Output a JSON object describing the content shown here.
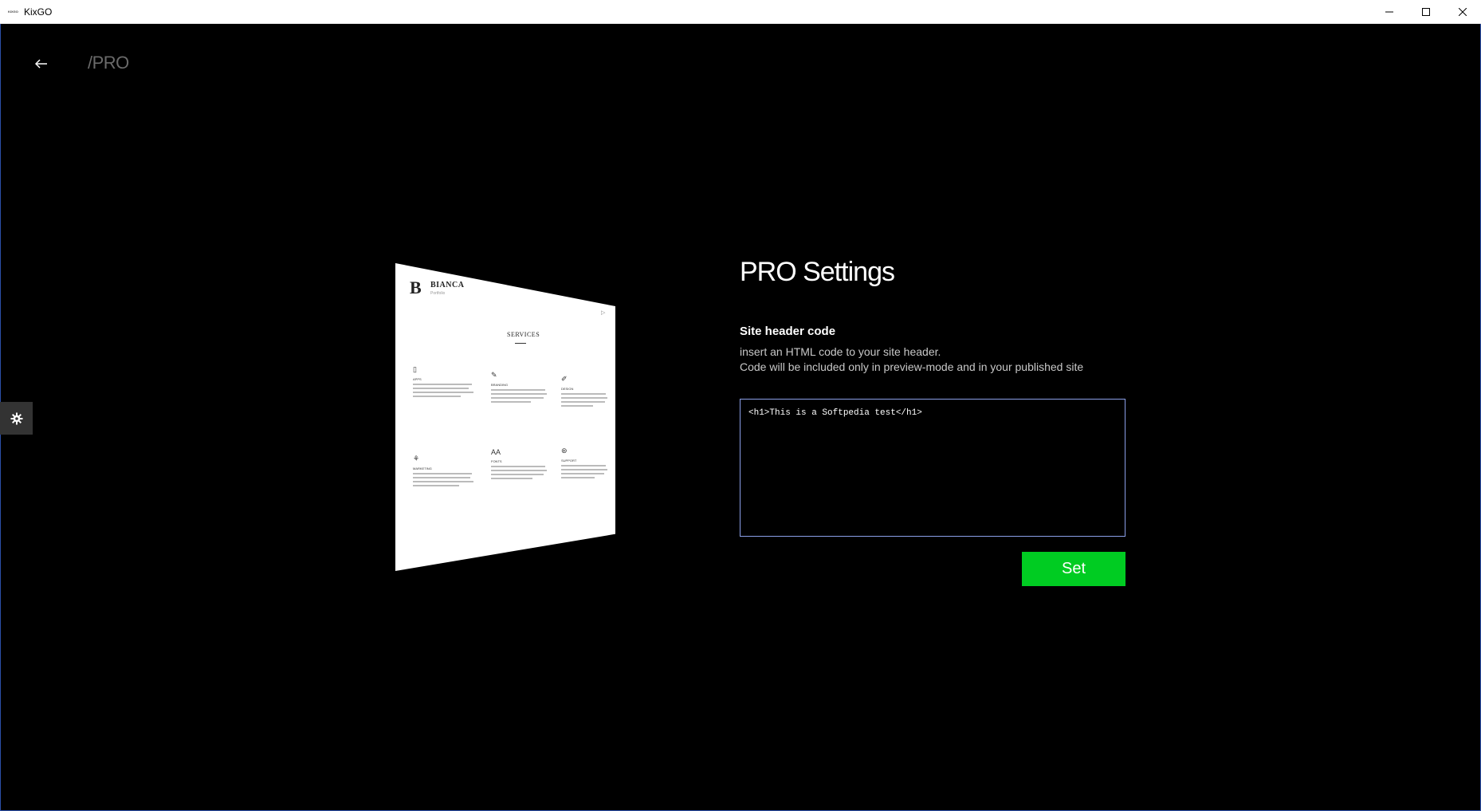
{
  "window": {
    "app_icon_text": "KIXGO",
    "title": "KixGO"
  },
  "header": {
    "breadcrumb": "/PRO"
  },
  "preview": {
    "logo_letter": "B",
    "brand": "BIANCA",
    "brand_sub": "Portfolio",
    "arrow": "▷",
    "section_title": "SERVICES",
    "items": [
      {
        "icon": "▯",
        "label": "APPS"
      },
      {
        "icon": "✎",
        "label": "BRANDING"
      },
      {
        "icon": "✐",
        "label": "DESIGN"
      },
      {
        "icon": "⚘",
        "label": "MARKETING"
      },
      {
        "icon": "AA",
        "label": "FONTS"
      },
      {
        "icon": "⊛",
        "label": "SUPPORT"
      }
    ]
  },
  "settings": {
    "title": "PRO Settings",
    "section_label": "Site header code",
    "description_line1": "insert an HTML code to your site header.",
    "description_line2": "Code will be included only in preview-mode and in your published site",
    "code_value": "<h1>This is a Softpedia test</h1>",
    "set_label": "Set"
  },
  "colors": {
    "background": "#000000",
    "accent_button": "#00cc22",
    "input_border": "#8b9fe8",
    "side_button": "#333333"
  },
  "icons": {
    "back": "arrow-left-icon",
    "settings": "gear-icon",
    "minimize": "minimize-icon",
    "maximize": "maximize-icon",
    "close": "close-icon"
  }
}
